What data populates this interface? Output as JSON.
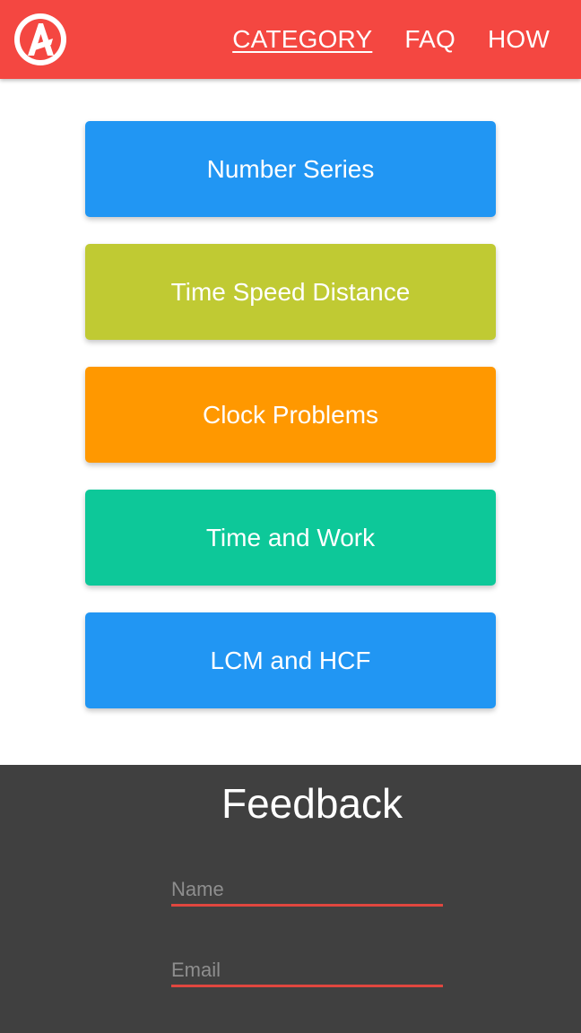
{
  "header": {
    "logo_letter": "A",
    "colors": {
      "background": "#f44741",
      "text": "#ffffff"
    },
    "nav": [
      {
        "label": "CATEGORY",
        "active": true
      },
      {
        "label": "FAQ",
        "active": false
      },
      {
        "label": "HOW",
        "active": false
      }
    ]
  },
  "categories": [
    {
      "label": "Number Series",
      "color": "#2196f3"
    },
    {
      "label": "Time Speed Distance",
      "color": "#c0ca33"
    },
    {
      "label": "Clock Problems",
      "color": "#ff9800"
    },
    {
      "label": "Time and Work",
      "color": "#0dc899"
    },
    {
      "label": "LCM and HCF",
      "color": "#2196f3"
    }
  ],
  "feedback": {
    "title": "Feedback",
    "background": "#404040",
    "accent": "#e0473f",
    "fields": {
      "name": {
        "placeholder": "Name",
        "value": ""
      },
      "email": {
        "placeholder": "Email",
        "value": ""
      }
    }
  }
}
